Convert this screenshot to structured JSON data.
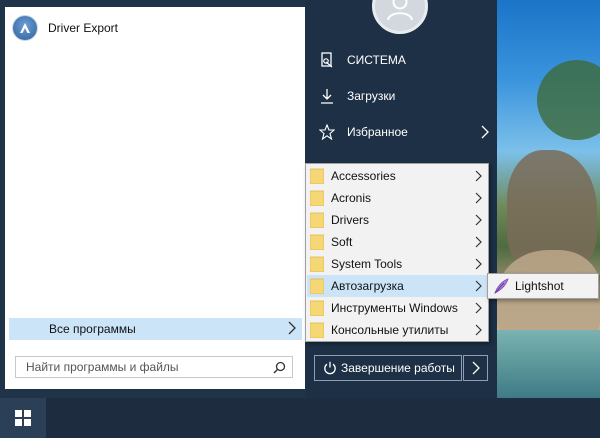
{
  "left_panel": {
    "pinned": [
      {
        "label": "Driver Export",
        "icon": "driver-export-icon"
      }
    ],
    "all_programs_label": "Все программы",
    "search": {
      "placeholder": "Найти программы и файлы",
      "value": ""
    }
  },
  "right_panel": {
    "items": [
      {
        "label": "СИСТЕМА",
        "icon": "computer-icon"
      },
      {
        "label": "Загрузки",
        "icon": "download-icon"
      },
      {
        "label": "Избранное",
        "icon": "star-icon"
      }
    ],
    "shutdown_label": "Завершение работы"
  },
  "programs_menu": {
    "items": [
      {
        "label": "Accessories",
        "has_submenu": true
      },
      {
        "label": "Acronis",
        "has_submenu": true
      },
      {
        "label": "Drivers",
        "has_submenu": true
      },
      {
        "label": "Soft",
        "has_submenu": true
      },
      {
        "label": "System Tools",
        "has_submenu": true
      },
      {
        "label": "Автозагрузка",
        "has_submenu": true,
        "highlighted": true
      },
      {
        "label": "Инструменты Windows",
        "has_submenu": true
      },
      {
        "label": "Консольные утилиты",
        "has_submenu": true
      }
    ]
  },
  "autostart_menu": {
    "items": [
      {
        "label": "Lightshot",
        "icon": "lightshot-feather-icon"
      }
    ]
  },
  "colors": {
    "highlight": "#cce4f7",
    "dark_panel": "#1d3046",
    "folder": "#f6d776"
  }
}
